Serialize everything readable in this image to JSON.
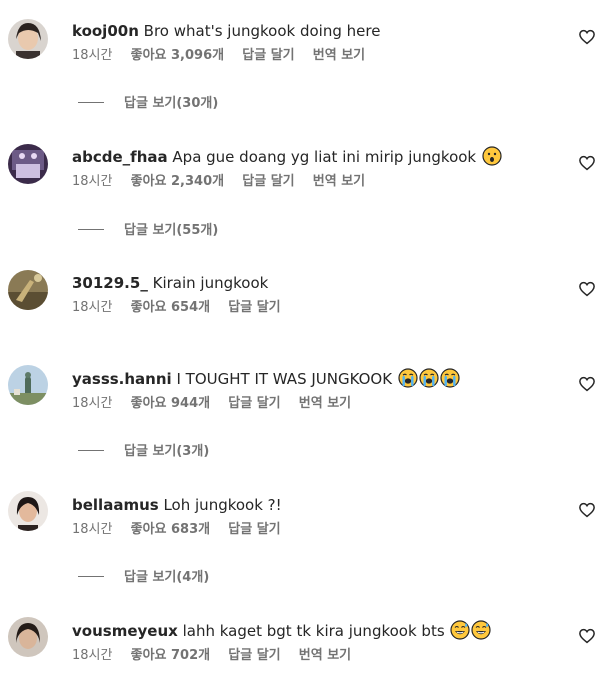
{
  "comments": [
    {
      "username": "kooj00n",
      "text": "Bro what's jungkook doing here",
      "emojis": [],
      "time": "18시간",
      "likes": "좋아요 3,096개",
      "reply": "답글 달기",
      "translate": "번역 보기",
      "view_replies": "답글 보기(30개)"
    },
    {
      "username": "abcde_fhaa",
      "text": "Apa gue doang yg liat ini mirip jungkook",
      "emojis": [
        "surprised-face"
      ],
      "time": "18시간",
      "likes": "좋아요 2,340개",
      "reply": "답글 달기",
      "translate": "번역 보기",
      "view_replies": "답글 보기(55개)"
    },
    {
      "username": "30129.5_",
      "text": "Kirain jungkook",
      "emojis": [],
      "time": "18시간",
      "likes": "좋아요 654개",
      "reply": "답글 달기",
      "translate": "",
      "view_replies": ""
    },
    {
      "username": "yasss.hanni",
      "text": "I TOUGHT IT WAS JUNGKOOK",
      "emojis": [
        "loudly-crying-face",
        "loudly-crying-face",
        "loudly-crying-face"
      ],
      "time": "18시간",
      "likes": "좋아요 944개",
      "reply": "답글 달기",
      "translate": "번역 보기",
      "view_replies": "답글 보기(3개)"
    },
    {
      "username": "bellaamus",
      "text": "Loh jungkook ?!",
      "emojis": [],
      "time": "18시간",
      "likes": "좋아요 683개",
      "reply": "답글 달기",
      "translate": "",
      "view_replies": "답글 보기(4개)"
    },
    {
      "username": "vousmeyeux",
      "text": "lahh kaget bgt tk kira jungkook bts",
      "emojis": [
        "grinning-sweat-face",
        "grinning-sweat-face"
      ],
      "time": "18시간",
      "likes": "좋아요 702개",
      "reply": "답글 달기",
      "translate": "번역 보기",
      "view_replies": ""
    }
  ],
  "icons": {
    "like": "heart-outline-icon"
  },
  "colors": {
    "text": "#262626",
    "meta": "#737373",
    "emoji_yellow": "#FFC83D",
    "tears": "#4FB3F6"
  }
}
